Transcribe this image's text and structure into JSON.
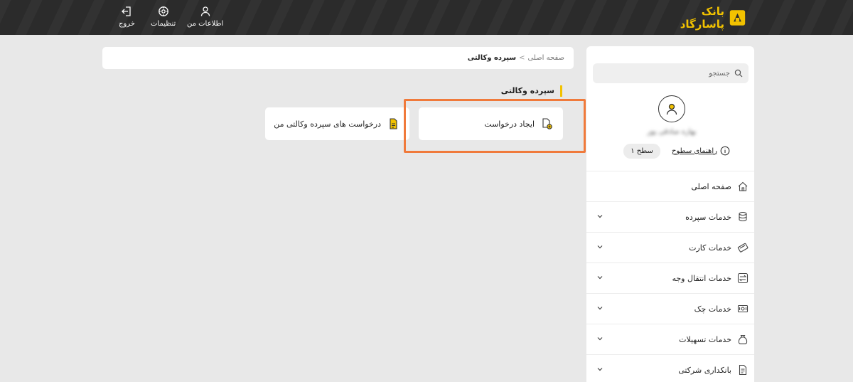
{
  "header": {
    "logo_text": "بانک پاسارگاد",
    "actions": [
      {
        "label": "اطلاعات من",
        "icon": "user-icon"
      },
      {
        "label": "تنظیمات",
        "icon": "gear-icon"
      },
      {
        "label": "خروج",
        "icon": "logout-icon"
      }
    ]
  },
  "breadcrumb": {
    "home": "صفحه اصلی",
    "separator": ">",
    "current": "سپرده وکالتی"
  },
  "section": {
    "title": "سپرده وکالتی"
  },
  "cards": [
    {
      "label": "ایجاد درخواست",
      "icon": "document-add-icon"
    },
    {
      "label": "درخواست های سپرده وکالتی من",
      "icon": "document-list-icon"
    }
  ],
  "sidebar": {
    "search_placeholder": "جستجو",
    "user_name": "بهاره صادقی پور",
    "guide_label": "راهنمای سطوح",
    "level": "سطح ۱",
    "menu": [
      {
        "label": "صفحه اصلی",
        "icon": "home-icon",
        "expandable": false
      },
      {
        "label": "خدمات سپرده",
        "icon": "coins-icon",
        "expandable": true
      },
      {
        "label": "خدمات کارت",
        "icon": "card-icon",
        "expandable": true
      },
      {
        "label": "خدمات انتقال وجه",
        "icon": "transfer-icon",
        "expandable": true
      },
      {
        "label": "خدمات چک",
        "icon": "cheque-icon",
        "expandable": true
      },
      {
        "label": "خدمات تسهیلات",
        "icon": "loan-bag-icon",
        "expandable": true
      },
      {
        "label": "بانکداری شرکتی",
        "icon": "corporate-document-icon",
        "expandable": true
      }
    ]
  },
  "colors": {
    "header_bg": "#2b2b2b",
    "accent": "#f2c200",
    "highlight": "#f07a3b",
    "page_bg": "#e8e8e8"
  }
}
